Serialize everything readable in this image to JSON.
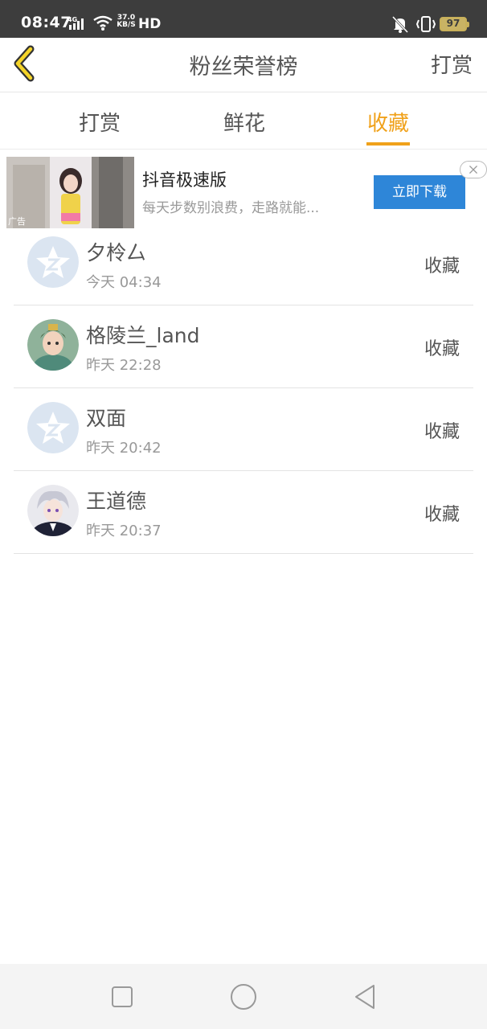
{
  "status_bar": {
    "time": "08:47",
    "network": "4G",
    "speed_value": "37.0",
    "speed_unit": "KB/S",
    "hd": "HD",
    "battery": "97",
    "icons": [
      "signal-icon",
      "wifi-icon",
      "mute-icon",
      "vibrate-icon",
      "battery-icon"
    ]
  },
  "header": {
    "back_icon": "chevron-left-icon",
    "title": "粉丝荣誉榜",
    "right_label": "打赏"
  },
  "tabs": [
    {
      "label": "打赏",
      "active": false
    },
    {
      "label": "鲜花",
      "active": false
    },
    {
      "label": "收藏",
      "active": true
    }
  ],
  "ad": {
    "title": "抖音极速版",
    "description": "每天步数别浪费，走路就能...",
    "button": "立即下载",
    "tag": "广告",
    "close_icon": "close-icon"
  },
  "list": [
    {
      "name": "夕柃厶",
      "time": "今天 04:34",
      "action": "收藏",
      "avatar": "default-avatar"
    },
    {
      "name": "格陵兰_land",
      "time": "昨天 22:28",
      "action": "收藏",
      "avatar": "user-avatar"
    },
    {
      "name": "双面",
      "time": "昨天 20:42",
      "action": "收藏",
      "avatar": "default-avatar"
    },
    {
      "name": "王道德",
      "time": "昨天 20:37",
      "action": "收藏",
      "avatar": "user-avatar"
    }
  ],
  "navbar": {
    "icons": [
      "recents-icon",
      "home-icon",
      "back-icon"
    ]
  },
  "colors": {
    "accent": "#f0a11a",
    "status_bar": "#3d3d3d",
    "ad_button": "#2e86d8",
    "text": "#555555",
    "subtext": "#999999"
  }
}
